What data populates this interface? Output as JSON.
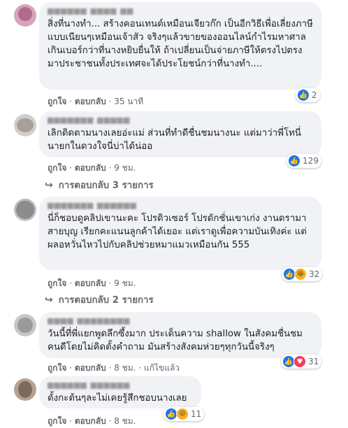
{
  "comments": [
    {
      "text": "สิ่งที่นางทำ... สร้างคอนเทนต์เหมือนเจียวก๊ก เป็นอีกวิธีเพื่อเลี่ยงภาษีแบบเนียนๆเหมือนเจ้าสัว จริงๆแล้วขายของออนไลน์กำไรมหาศาลเกินเบอร์กว่าที่นางหยิบยื่นให้ ถ้าเปลี่ยนเป็นจ่ายภาษีให้ตรงไปตรงมาประชาชนทั้งประเทศจะได้ประโยชน์กว่าที่นางทำ....",
      "like": "ถูกใจ",
      "reply": "ตอบกลับ",
      "time": "35 นาที",
      "reaction_count": "2"
    },
    {
      "text": "เลิกติดตามนางเลยอ่ะแม่ ส่วนที่ทำดีชื่นชมนางนะ แต่มาว่าพี่โทนี่นายกในดวงใจนี่บ่าได้น่ออ",
      "like": "ถูกใจ",
      "reply": "ตอบกลับ",
      "time": "9 ชม.",
      "reaction_count": "129",
      "replies_label": "การตอบกลับ 3 รายการ"
    },
    {
      "text": "นี่ก็ชอบดูคลิปเขานะคะ โปรดิวเซอร์ โปรดักชั่นเขาเก่ง งานดรามาสายบุญ เรียกคะแนนลูกค้าได้เยอะ แต่เราดูเพื่อความบันเทิงค่ะ แต่ผลอหวั่นไหวไปกับคลิปช่วยหมาแมวเหมือนกัน 555",
      "like": "ถูกใจ",
      "reply": "ตอบกลับ",
      "time": "9 ชม.",
      "reaction_count": "32",
      "replies_label": "การตอบกลับ 2 รายการ"
    },
    {
      "text": "วันนี้ที่พี่แยกพูดลึกซึ้งมาก ประเด็นความ shallow ในสังคมชื่นชมคนดีโดยไม่คิดตั้งคำถาม มันสร้างสังคมห่วยๆทุกวันนี้จริงๆ",
      "like": "ถูกใจ",
      "reply": "ตอบกลับ",
      "time": "8 ชม.",
      "edited": "แก้ไขแล้ว",
      "reaction_count": "31"
    },
    {
      "text": "ตั้งกะต้นๆละไม่เคยรู้สึกชอบนางเลย",
      "like": "ถูกใจ",
      "reply": "ตอบกลับ",
      "time": "8 ชม.",
      "reaction_count": "11"
    }
  ],
  "icons": {
    "like": "thumbs-up-icon",
    "haha": "laughing-face-icon",
    "love": "heart-icon",
    "wow": "surprised-face-icon",
    "reply_arrow": "reply-arrow-icon"
  },
  "colors": {
    "bubble": "#f0f2f5",
    "meta": "#65676b",
    "like": "#1877f2",
    "love": "#f33e58",
    "haha": "#f7b125"
  }
}
